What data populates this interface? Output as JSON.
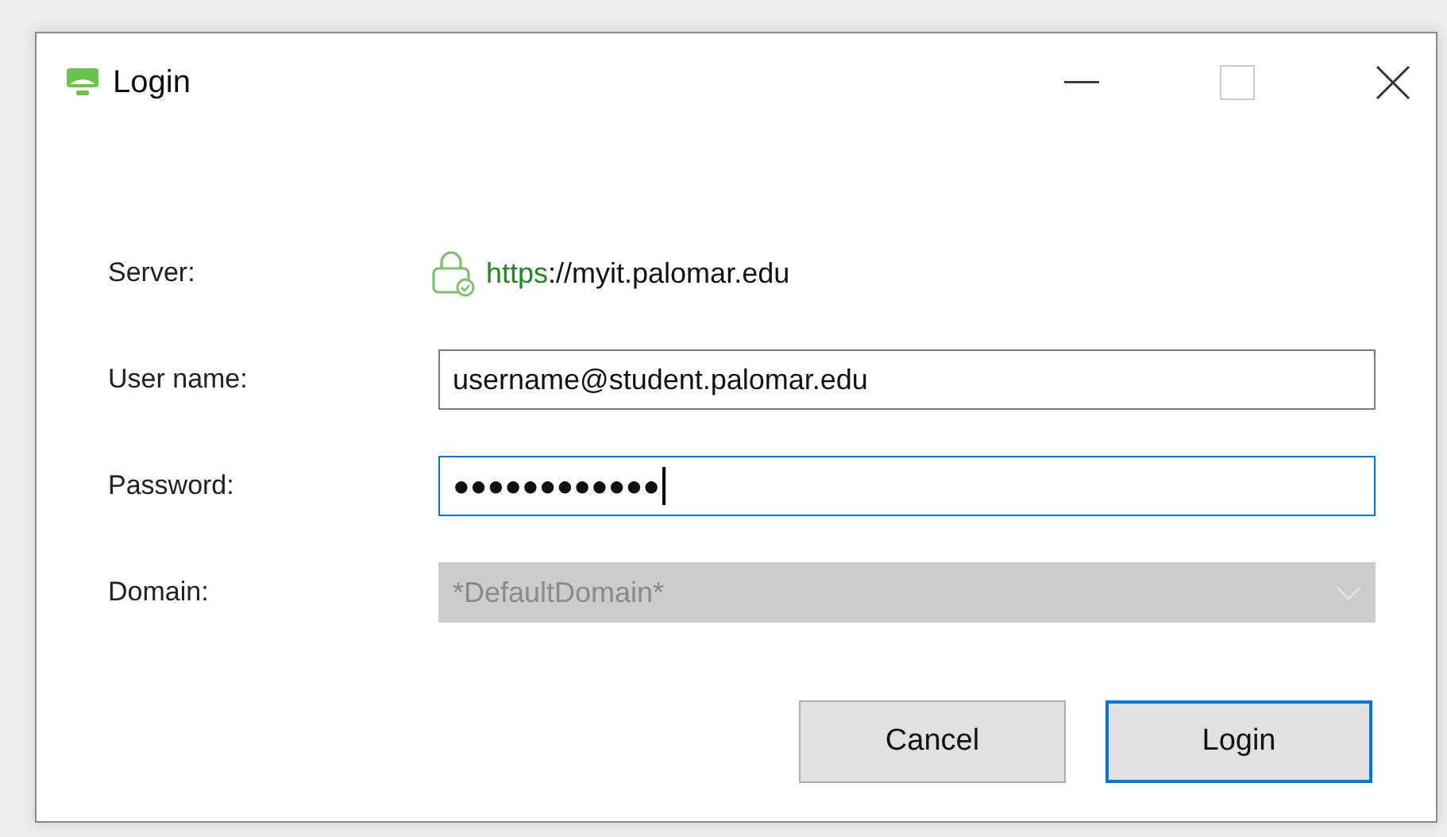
{
  "window": {
    "title": "Login"
  },
  "server": {
    "label": "Server:",
    "scheme": "https",
    "rest": "://myit.palomar.edu"
  },
  "fields": [
    {
      "kind": "text",
      "label": "User name:",
      "value": "username@student.palomar.edu",
      "focused": false,
      "disabled": false
    },
    {
      "kind": "text",
      "label": "Password:",
      "value": "●●●●●●●●●●●●",
      "focused": true,
      "disabled": false
    },
    {
      "kind": "dropdown",
      "label": "Domain:",
      "value": "*DefaultDomain*",
      "focused": false,
      "disabled": true
    }
  ],
  "buttons": [
    {
      "label": "Cancel",
      "default": false
    },
    {
      "label": "Login",
      "default": true
    }
  ]
}
